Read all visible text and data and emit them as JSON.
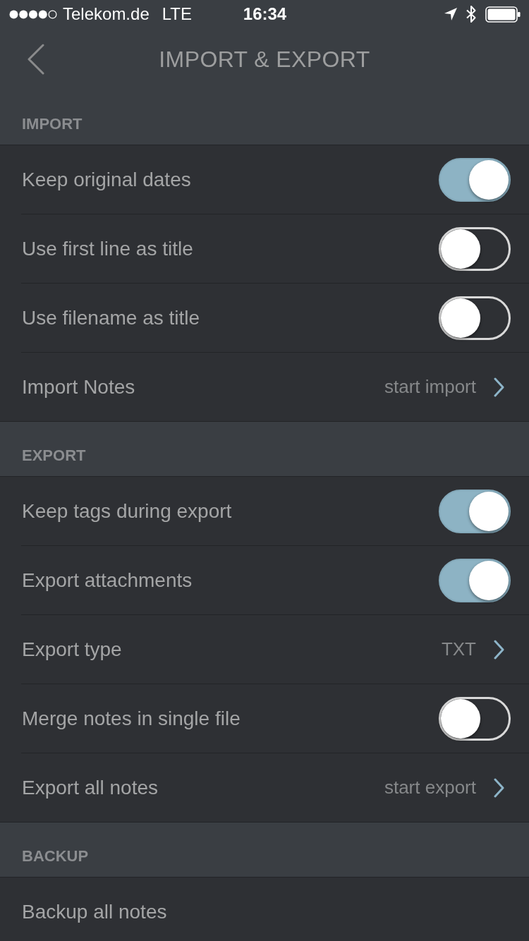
{
  "status_bar": {
    "carrier": "Telekom.de",
    "network": "LTE",
    "time": "16:34"
  },
  "nav_bar": {
    "title": "IMPORT & EXPORT"
  },
  "sections": [
    {
      "title": "IMPORT",
      "rows": [
        {
          "kind": "toggle",
          "label": "Keep original dates",
          "on": true
        },
        {
          "kind": "toggle",
          "label": "Use first line as title",
          "on": false
        },
        {
          "kind": "toggle",
          "label": "Use filename as title",
          "on": false
        },
        {
          "kind": "link",
          "label": "Import Notes",
          "value": "start import"
        }
      ]
    },
    {
      "title": "EXPORT",
      "rows": [
        {
          "kind": "toggle",
          "label": "Keep tags during export",
          "on": true
        },
        {
          "kind": "toggle",
          "label": "Export attachments",
          "on": true
        },
        {
          "kind": "link",
          "label": "Export type",
          "value": "TXT"
        },
        {
          "kind": "toggle",
          "label": "Merge notes in single file",
          "on": false
        },
        {
          "kind": "link",
          "label": "Export all notes",
          "value": "start export"
        }
      ]
    },
    {
      "title": "BACKUP",
      "rows": [
        {
          "kind": "action",
          "label": "Backup all notes"
        }
      ]
    }
  ]
}
